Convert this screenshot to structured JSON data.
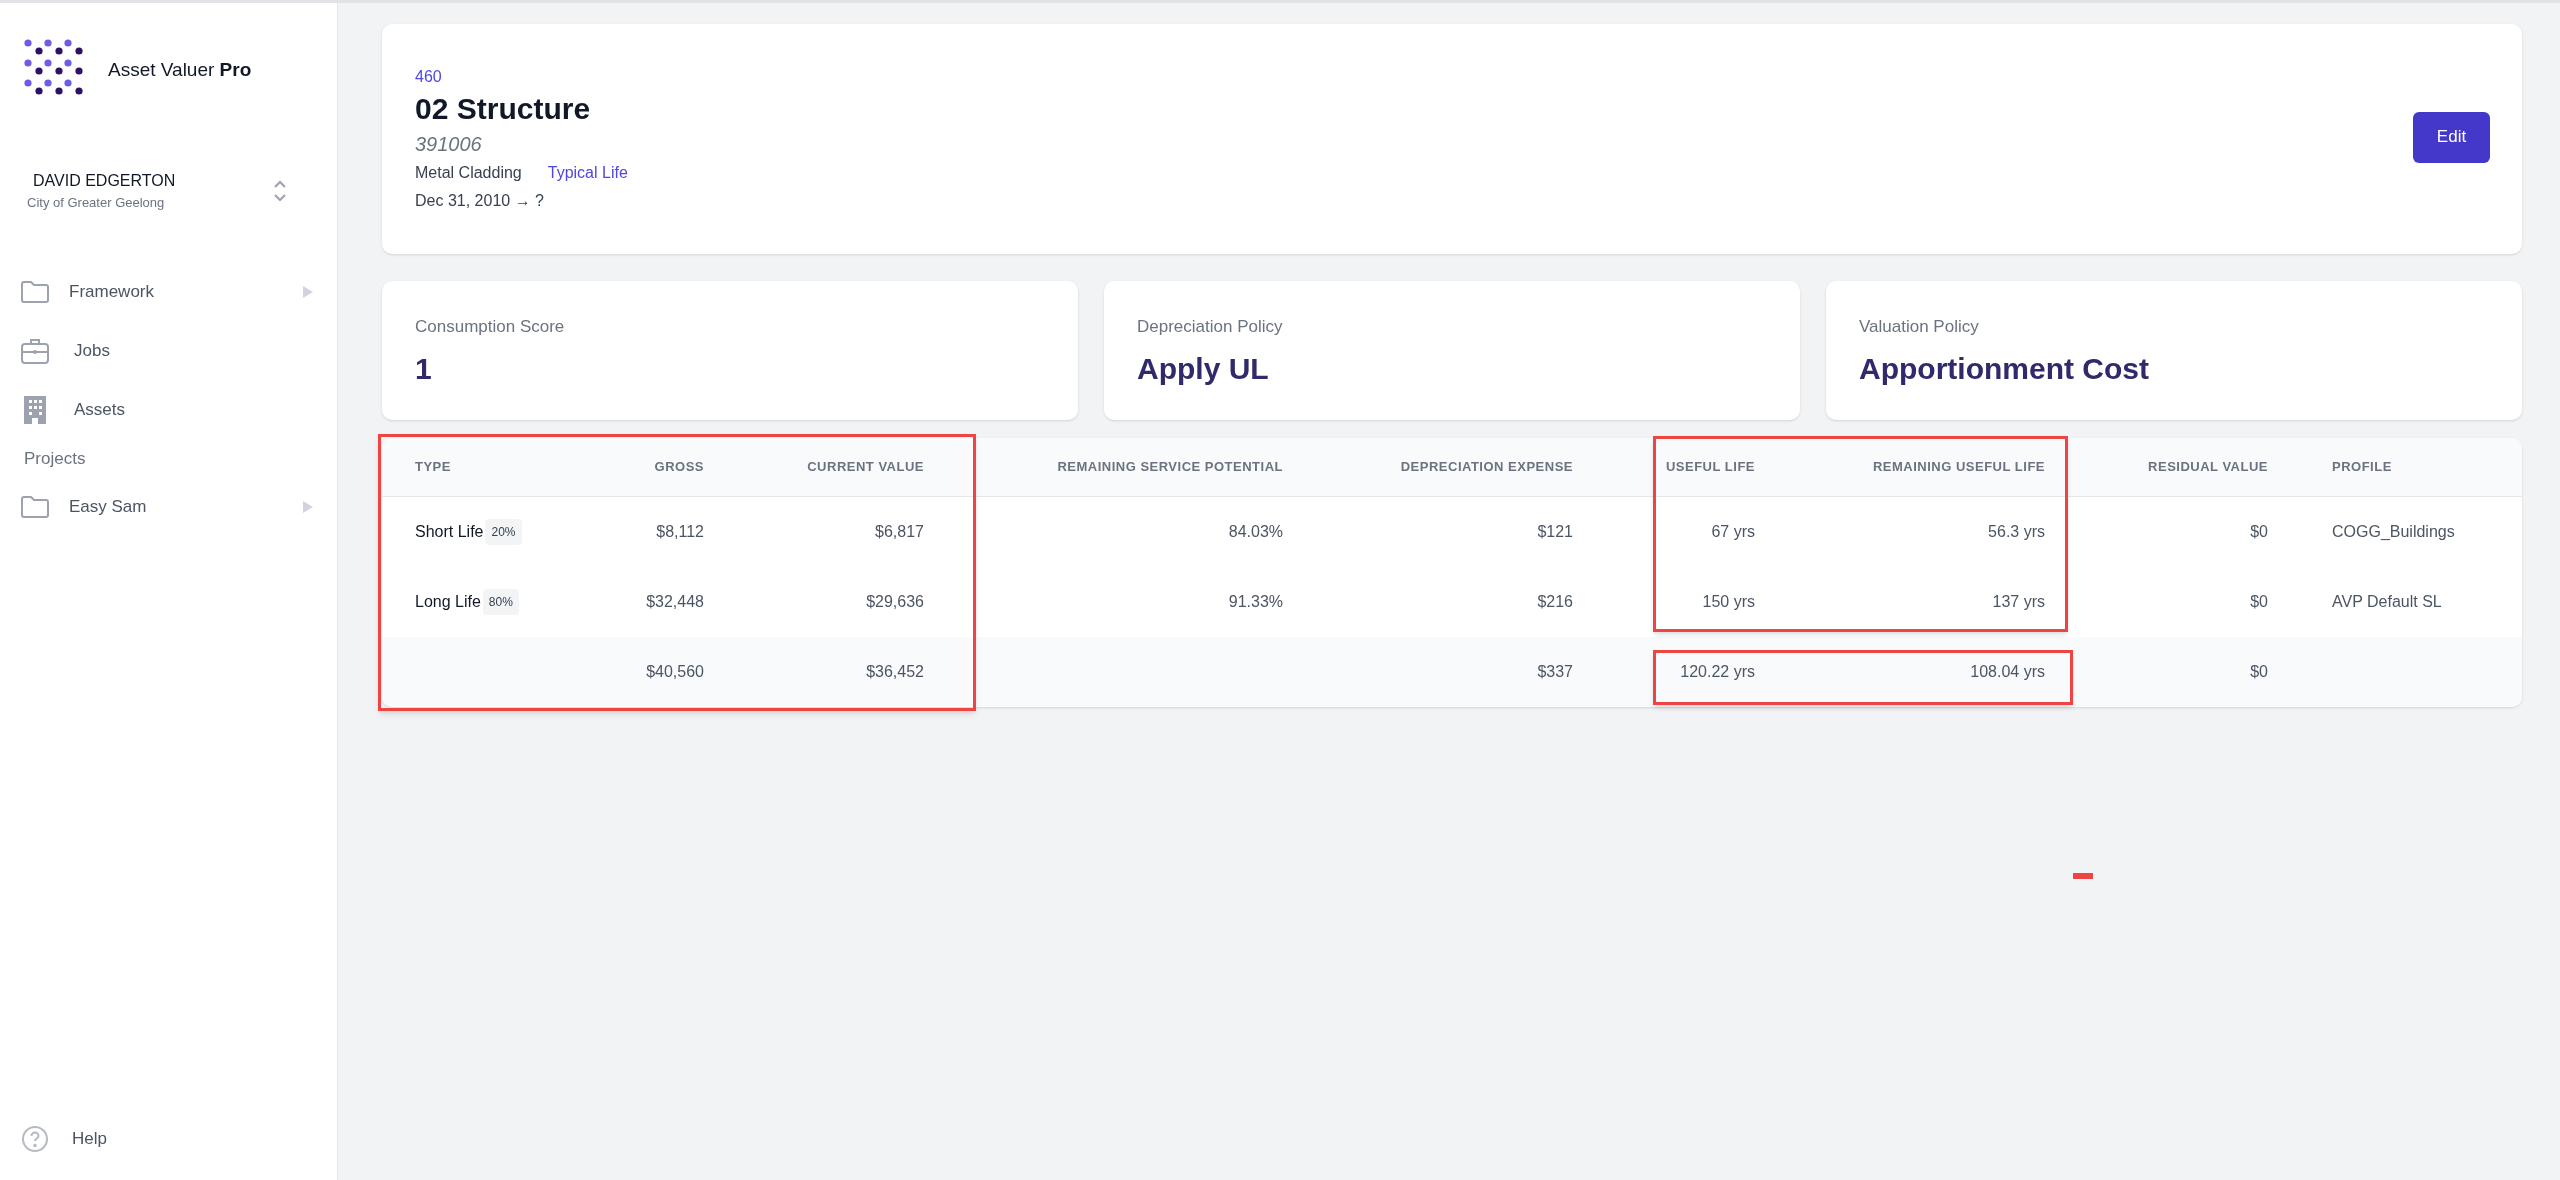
{
  "sidebar": {
    "brand": "Asset Valuer **Pro**",
    "user": {
      "name": "DAVID EDGERTON",
      "organisation": "City of Greater Geelong"
    },
    "items": [
      {
        "kind": "folder",
        "label": "Framework",
        "expandable": true
      },
      {
        "kind": "briefcase",
        "label": "Jobs",
        "expandable": false
      },
      {
        "kind": "building",
        "label": "Assets",
        "expandable": false
      },
      {
        "kind": "heading",
        "label": "Projects"
      },
      {
        "kind": "folder",
        "label": "Easy Sam",
        "expandable": true
      }
    ],
    "help": "Help"
  },
  "asset": {
    "number": "460",
    "title": "02 Structure",
    "code": "391006",
    "material": "Metal Cladding",
    "life_link": "Typical Life",
    "dates": "Dec 31, 2010 → ?",
    "edit_button": "Edit"
  },
  "stats": [
    {
      "label": "Consumption Score",
      "value": "1"
    },
    {
      "label": "Depreciation Policy",
      "value": "Apply UL"
    },
    {
      "label": "Valuation Policy",
      "value": "Apportionment Cost"
    }
  ],
  "table": {
    "columns": [
      "TYPE",
      "GROSS",
      "CURRENT VALUE",
      "REMAINING SERVICE POTENTIAL",
      "DEPRECIATION EXPENSE",
      "USEFUL LIFE",
      "REMAINING USEFUL LIFE",
      "RESIDUAL VALUE",
      "PROFILE"
    ],
    "rows": [
      {
        "share": "20%",
        "cells": [
          "Short Life",
          "$8,112",
          "$6,817",
          "84.03%",
          "$121",
          "67 yrs",
          "56.3 yrs",
          "$0",
          "COGG_Buildings"
        ]
      },
      {
        "share": "80%",
        "cells": [
          "Long Life",
          "$32,448",
          "$29,636",
          "91.33%",
          "$216",
          "150 yrs",
          "137 yrs",
          "$0",
          "AVP Default SL"
        ]
      }
    ],
    "total": {
      "gross": "$40,560",
      "current_value": "$36,452",
      "depreciation_expense": "$337",
      "useful_life": "120.22 yrs",
      "remaining_useful_life": "108.04 yrs",
      "residual_value": "$0"
    }
  },
  "annotations": {
    "highlights": [
      {
        "kind": "value-columns"
      },
      {
        "kind": "life-columns"
      },
      {
        "kind": "life-total"
      }
    ],
    "stray_dash": true
  }
}
